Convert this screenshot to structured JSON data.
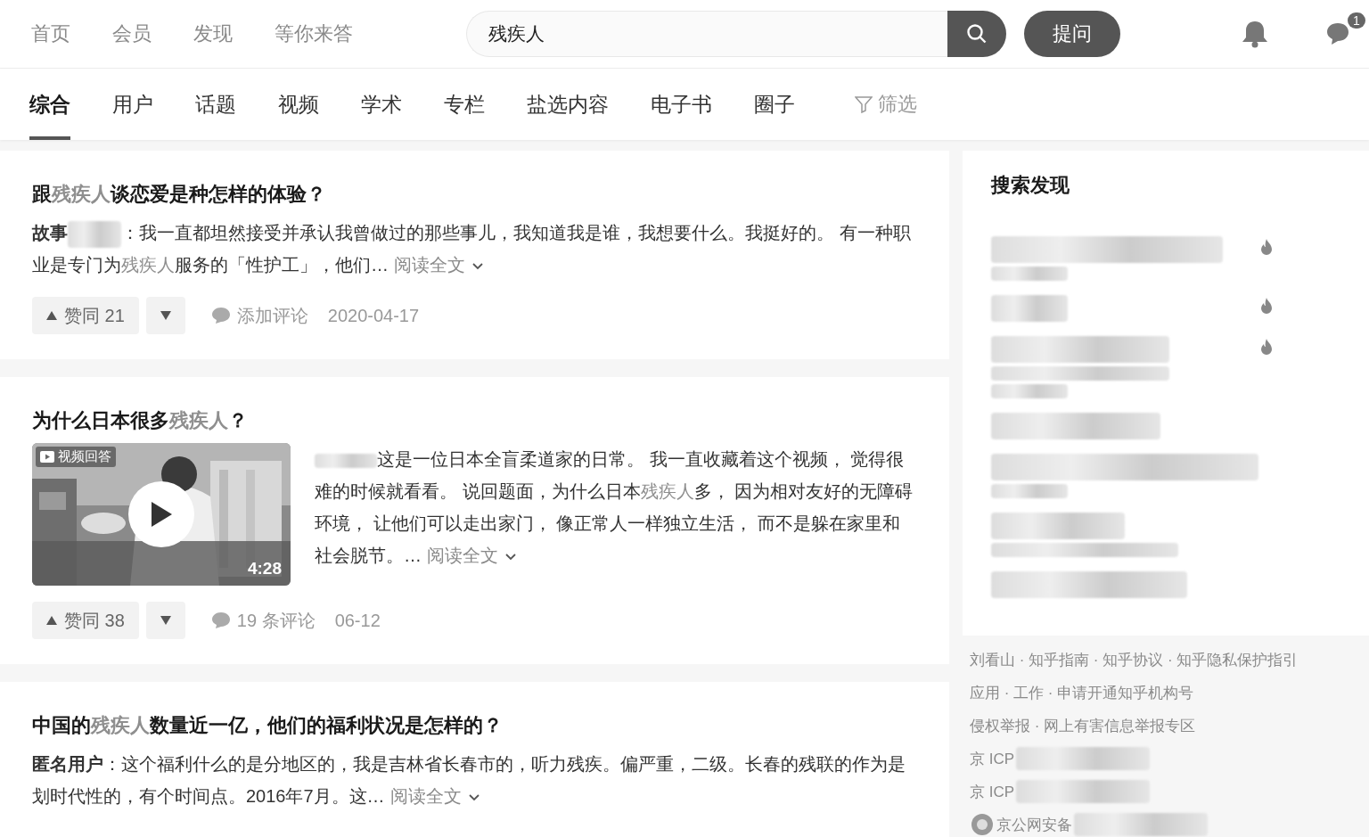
{
  "nav": {
    "links": [
      {
        "label": "首页"
      },
      {
        "label": "会员"
      },
      {
        "label": "发现"
      },
      {
        "label": "等你来答"
      }
    ],
    "search": {
      "value": "残疾人"
    },
    "ask_button": "提问",
    "message_badge": "1"
  },
  "tabs": [
    {
      "label": "综合",
      "selected": true
    },
    {
      "label": "用户",
      "selected": false
    },
    {
      "label": "话题",
      "selected": false
    },
    {
      "label": "视频",
      "selected": false
    },
    {
      "label": "学术",
      "selected": false
    },
    {
      "label": "专栏",
      "selected": false
    },
    {
      "label": "盐选内容",
      "selected": false
    },
    {
      "label": "电子书",
      "selected": false
    },
    {
      "label": "圈子",
      "selected": false
    }
  ],
  "filter": "筛选",
  "results": [
    {
      "kind": "text",
      "title": [
        {
          "text": "跟",
          "highlight": false
        },
        {
          "text": "残疾人",
          "highlight": true
        },
        {
          "text": "谈恋爱是种怎样的体验？",
          "highlight": false
        }
      ],
      "author": "故事",
      "author_blurred": true,
      "excerpt": [
        {
          "text": "：我一直都坦然接受并承认我曾做过的那些事儿，我知道我是谁，我想要什么。我挺好的。 有一种职业是专门为",
          "highlight": false
        },
        {
          "text": "残疾人",
          "highlight": true
        },
        {
          "text": "服务的「性护工」，他们…",
          "highlight": false
        }
      ],
      "read_more": "阅读全文",
      "vote": "赞同 21",
      "comment": "添加评论",
      "date": "2020-04-17"
    },
    {
      "kind": "video",
      "title": [
        {
          "text": "为什么日本很多",
          "highlight": false
        },
        {
          "text": "残疾人",
          "highlight": true
        },
        {
          "text": "？",
          "highlight": false
        }
      ],
      "video_badge": "视频回答",
      "duration": "4:28",
      "author_blurred": true,
      "excerpt": [
        {
          "text": "这是一位日本全盲柔道家的日常。 我一直收藏着这个视频， 觉得很难的时候就看看。 说回题面，为什么日本",
          "highlight": false
        },
        {
          "text": "残疾人",
          "highlight": true
        },
        {
          "text": "多， 因为相对友好的无障碍环境， 让他们可以走出家门， 像正常人一样独立生活， 而不是躲在家里和社会脱节。…",
          "highlight": false
        }
      ],
      "read_more": "阅读全文",
      "vote": "赞同 38",
      "comment": "19 条评论",
      "date": "06-12"
    },
    {
      "kind": "text",
      "title": [
        {
          "text": "中国的",
          "highlight": false
        },
        {
          "text": "残疾人",
          "highlight": true
        },
        {
          "text": "数量近一亿，他们的福利状况是怎样的？",
          "highlight": false
        }
      ],
      "author": "匿名用户",
      "author_blurred": false,
      "excerpt": [
        {
          "text": "：这个福利什么的是分地区的，我是吉林省长春市的，听力残疾。偏严重，二级。长春的残联的作为是划时代性的，有个时间点。2016年7月。这…",
          "highlight": false
        }
      ],
      "read_more": "阅读全文"
    }
  ],
  "sidebar": {
    "title": "搜索发现",
    "items": [
      {
        "hot": true
      },
      {
        "hot": true
      },
      {
        "hot": true
      },
      {
        "hot": false
      },
      {
        "hot": false
      },
      {
        "hot": false
      },
      {
        "hot": false
      }
    ],
    "footer": [
      {
        "text": "刘看山 · 知乎指南 · 知乎协议 · 知乎隐私保护指引",
        "blurred": false,
        "badge": false
      },
      {
        "text": "应用 · 工作 · 申请开通知乎机构号",
        "blurred": false,
        "badge": false
      },
      {
        "text": "侵权举报 · 网上有害信息举报专区",
        "blurred": false,
        "badge": false
      },
      {
        "text": "京 ICP",
        "blurred": true,
        "badge": false
      },
      {
        "text": "京 ICP",
        "blurred": true,
        "badge": false
      },
      {
        "text": "京公网安备",
        "blurred": true,
        "badge": true
      }
    ]
  }
}
